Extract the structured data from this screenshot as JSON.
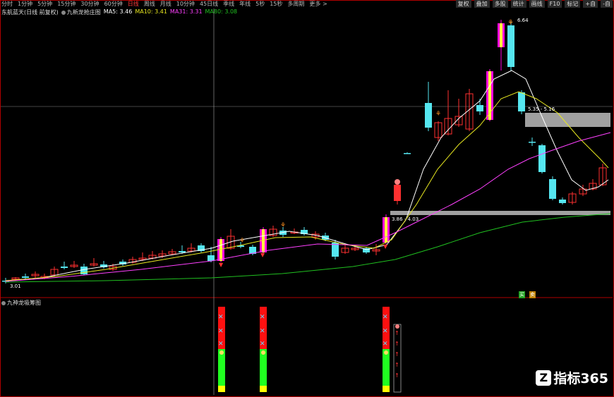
{
  "toolbar": {
    "items": [
      "分时",
      "1分钟",
      "5分钟",
      "15分钟",
      "30分钟",
      "60分钟",
      "日线",
      "周线",
      "月线",
      "10分钟",
      "45日线",
      "季线",
      "年线",
      "5秒",
      "15秒",
      "多周期",
      "更多 >"
    ],
    "selected_index": 6,
    "right_buttons": [
      "复权",
      "叠加",
      "多股",
      "统计",
      "画线",
      "F10",
      "标记",
      "+自",
      "-自"
    ]
  },
  "legend": {
    "stock": "东航蓝天(日线 前复权)",
    "indicator": "九新龙抢庄图",
    "ma5": "MA5: 3.46",
    "ma10": "MA10: 3.41",
    "ma31": "MA31: 3.31",
    "ma80": "MA80: 3.08"
  },
  "chart": {
    "high_label": "6.64",
    "low_label": "3.01",
    "zone_upper_label": "5.35 - 5.16",
    "zone_lower_label": "3.86 - 4.03",
    "marker_labels": [
      "买",
      "卖"
    ],
    "colors": {
      "up": "#ff3030",
      "down": "#55e6f0",
      "ma5": "#ffffff",
      "ma10": "#e8e820",
      "ma31": "#ff40ff",
      "ma80": "#20c020",
      "zone": "#a0a0a0"
    }
  },
  "sub_panel": {
    "title": "九神龙吸筹图"
  },
  "watermark": {
    "text": "指标365"
  }
}
